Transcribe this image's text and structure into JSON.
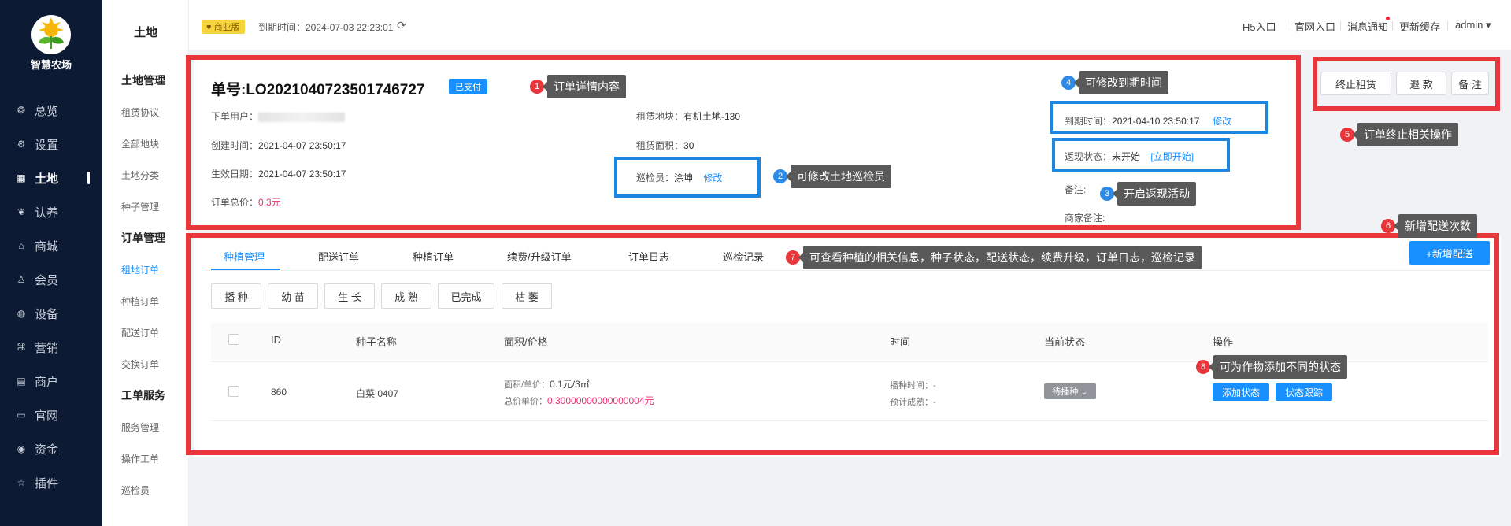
{
  "app": {
    "name": "智慧农场"
  },
  "sidebar": {
    "items": [
      {
        "label": "总览",
        "icon": "dashboard-icon"
      },
      {
        "label": "设置",
        "icon": "gear-icon"
      },
      {
        "label": "土地",
        "icon": "grid-icon"
      },
      {
        "label": "认养",
        "icon": "leaf-icon"
      },
      {
        "label": "商城",
        "icon": "store-icon"
      },
      {
        "label": "会员",
        "icon": "user-icon"
      },
      {
        "label": "设备",
        "icon": "device-icon"
      },
      {
        "label": "营销",
        "icon": "marketing-icon"
      },
      {
        "label": "商户",
        "icon": "shop-icon"
      },
      {
        "label": "官网",
        "icon": "website-icon"
      },
      {
        "label": "资金",
        "icon": "money-icon"
      },
      {
        "label": "插件",
        "icon": "star-icon"
      }
    ],
    "active_index": 2
  },
  "subnav": {
    "title": "土地",
    "sections": [
      {
        "heading": "土地管理",
        "items": [
          "租赁协议",
          "全部地块",
          "土地分类",
          "种子管理"
        ]
      },
      {
        "heading": "订单管理",
        "items": [
          "租地订单",
          "种植订单",
          "配送订单",
          "交换订单"
        ]
      },
      {
        "heading": "工单服务",
        "items": [
          "服务管理",
          "操作工单",
          "巡检员"
        ]
      }
    ],
    "active_item": "租地订单"
  },
  "header": {
    "edition": "商业版",
    "expire_label": "到期时间：2024-07-03 22:23:01",
    "nav": [
      "H5入口",
      "官网入口",
      "消息通知",
      "更新缓存"
    ],
    "user": "admin"
  },
  "order": {
    "number": "单号:LO2021040723501746727",
    "paid_label": "已支付",
    "user_label": "下单用户：",
    "created_label": "创建时间：",
    "created": "2021-04-07 23:50:17",
    "effective_label": "生效日期：",
    "effective": "2021-04-07 23:50:17",
    "total_label": "订单总价：",
    "total": "0.3元",
    "plot_label": "租赁地块：",
    "plot": "有机土地-130",
    "area_label": "租赁面积：",
    "area": "30",
    "inspector_label": "巡检员：",
    "inspector": "涂坤",
    "inspector_edit": "修改",
    "due_label": "到期时间：",
    "due": "2021-04-10 23:50:17",
    "due_edit": "修改",
    "cashback_label": "返现状态：",
    "cashback": "未开始",
    "cashback_action": "[立即开始]",
    "remark_label": "备注:",
    "merchant_remark_label": "商家备注:"
  },
  "actions": {
    "terminate": "终止租赁",
    "refund": "退 款",
    "remark": "备 注"
  },
  "annotations": [
    {
      "n": "1",
      "text": "订单详情内容",
      "color": "red"
    },
    {
      "n": "2",
      "text": "可修改土地巡检员",
      "color": "blue"
    },
    {
      "n": "3",
      "text": "开启返现活动",
      "color": "blue"
    },
    {
      "n": "4",
      "text": "可修改到期时间",
      "color": "blue"
    },
    {
      "n": "5",
      "text": "订单终止相关操作",
      "color": "red"
    },
    {
      "n": "6",
      "text": "新增配送次数",
      "color": "red"
    },
    {
      "n": "7",
      "text": "可查看种植的相关信息，种子状态，配送状态，续费升级，订单日志，巡检记录",
      "color": "red"
    },
    {
      "n": "8",
      "text": "可为作物添加不同的状态",
      "color": "red"
    }
  ],
  "tabs": [
    "种植管理",
    "配送订单",
    "种植订单",
    "续费/升级订单",
    "订单日志",
    "巡检记录"
  ],
  "add_delivery": "+新增配送",
  "filters": [
    "播 种",
    "幼 苗",
    "生 长",
    "成 熟",
    "已完成",
    "枯 萎"
  ],
  "table": {
    "headers": [
      "ID",
      "种子名称",
      "面积/价格",
      "时间",
      "当前状态",
      "操作"
    ],
    "row": {
      "id": "860",
      "seed": "白菜 0407",
      "unit_label": "面积/单价：",
      "unit": "0.1元/3㎡",
      "total_label": "总价单价：",
      "total": "0.30000000000000004元",
      "sow_label": "播种时间：-",
      "harvest_label": "预计成熟：-",
      "status": "待播种",
      "op_add": "添加状态",
      "op_track": "状态跟踪"
    }
  }
}
